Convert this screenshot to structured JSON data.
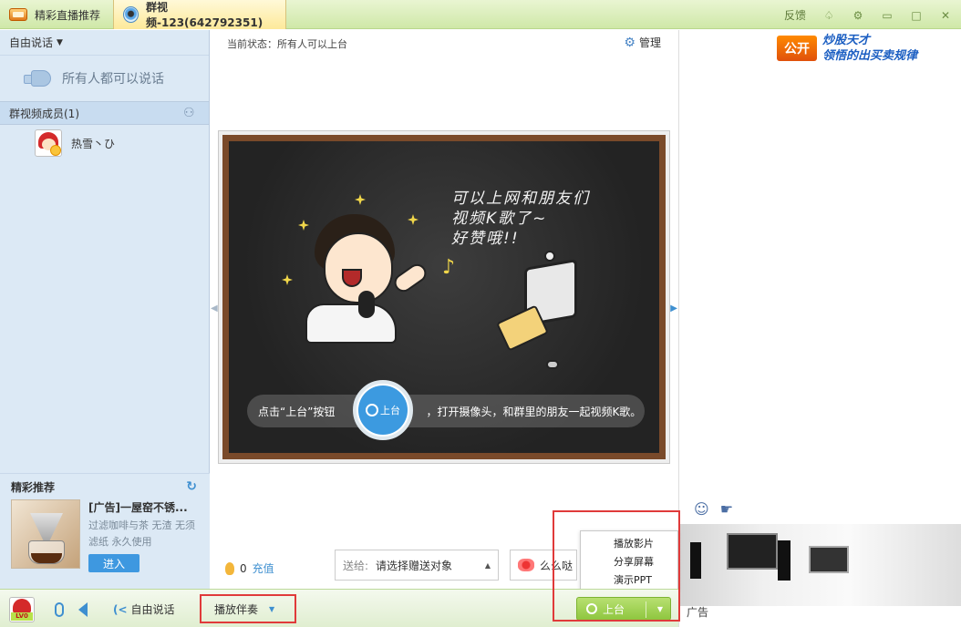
{
  "tabs": [
    {
      "label": "精彩直播推荐"
    },
    {
      "label": "群视频-123(642792351)"
    }
  ],
  "window": {
    "feedback": "反馈"
  },
  "left": {
    "free_talk": "自由说话",
    "all_can_talk": "所有人都可以说话",
    "members_title": "群视频成员(1)",
    "members": [
      {
        "name": "热雪丶ひ"
      }
    ],
    "recommend_title": "精彩推荐",
    "recommend": {
      "title": "[广告]一屋窑不锈...",
      "desc": "过滤咖啡与茶 无渣 无须滤纸 永久使用",
      "enter": "进入"
    }
  },
  "center": {
    "status": "当前状态：所有人可以上台",
    "manage": "管理",
    "chalk_lines": [
      "可以上网和朋友们",
      "视频K歌了~",
      "好赞哦!!"
    ],
    "callout_pre": "点击“上台”按钮",
    "callout_post": "，打开摄像头，和群里的朋友一起视频K歌。",
    "up_circle_label": "上台",
    "coins": "0",
    "recharge": "充值",
    "send_label": "送给:",
    "send_placeholder": "请选择赠送对象",
    "gift_label": "么么哒"
  },
  "play_menu": {
    "items": [
      {
        "label": "播放影片"
      },
      {
        "label": "分享屏幕"
      },
      {
        "label": "演示PPT"
      }
    ]
  },
  "right": {
    "ad_logo": "公开",
    "ad_line1": "炒股天才",
    "ad_line2": "领悟的出买卖规律",
    "ad_small": "广告"
  },
  "bottom": {
    "level": "LV0",
    "free_talk": "自由说话",
    "accompaniment": "播放伴奏",
    "up_button": "上台"
  }
}
